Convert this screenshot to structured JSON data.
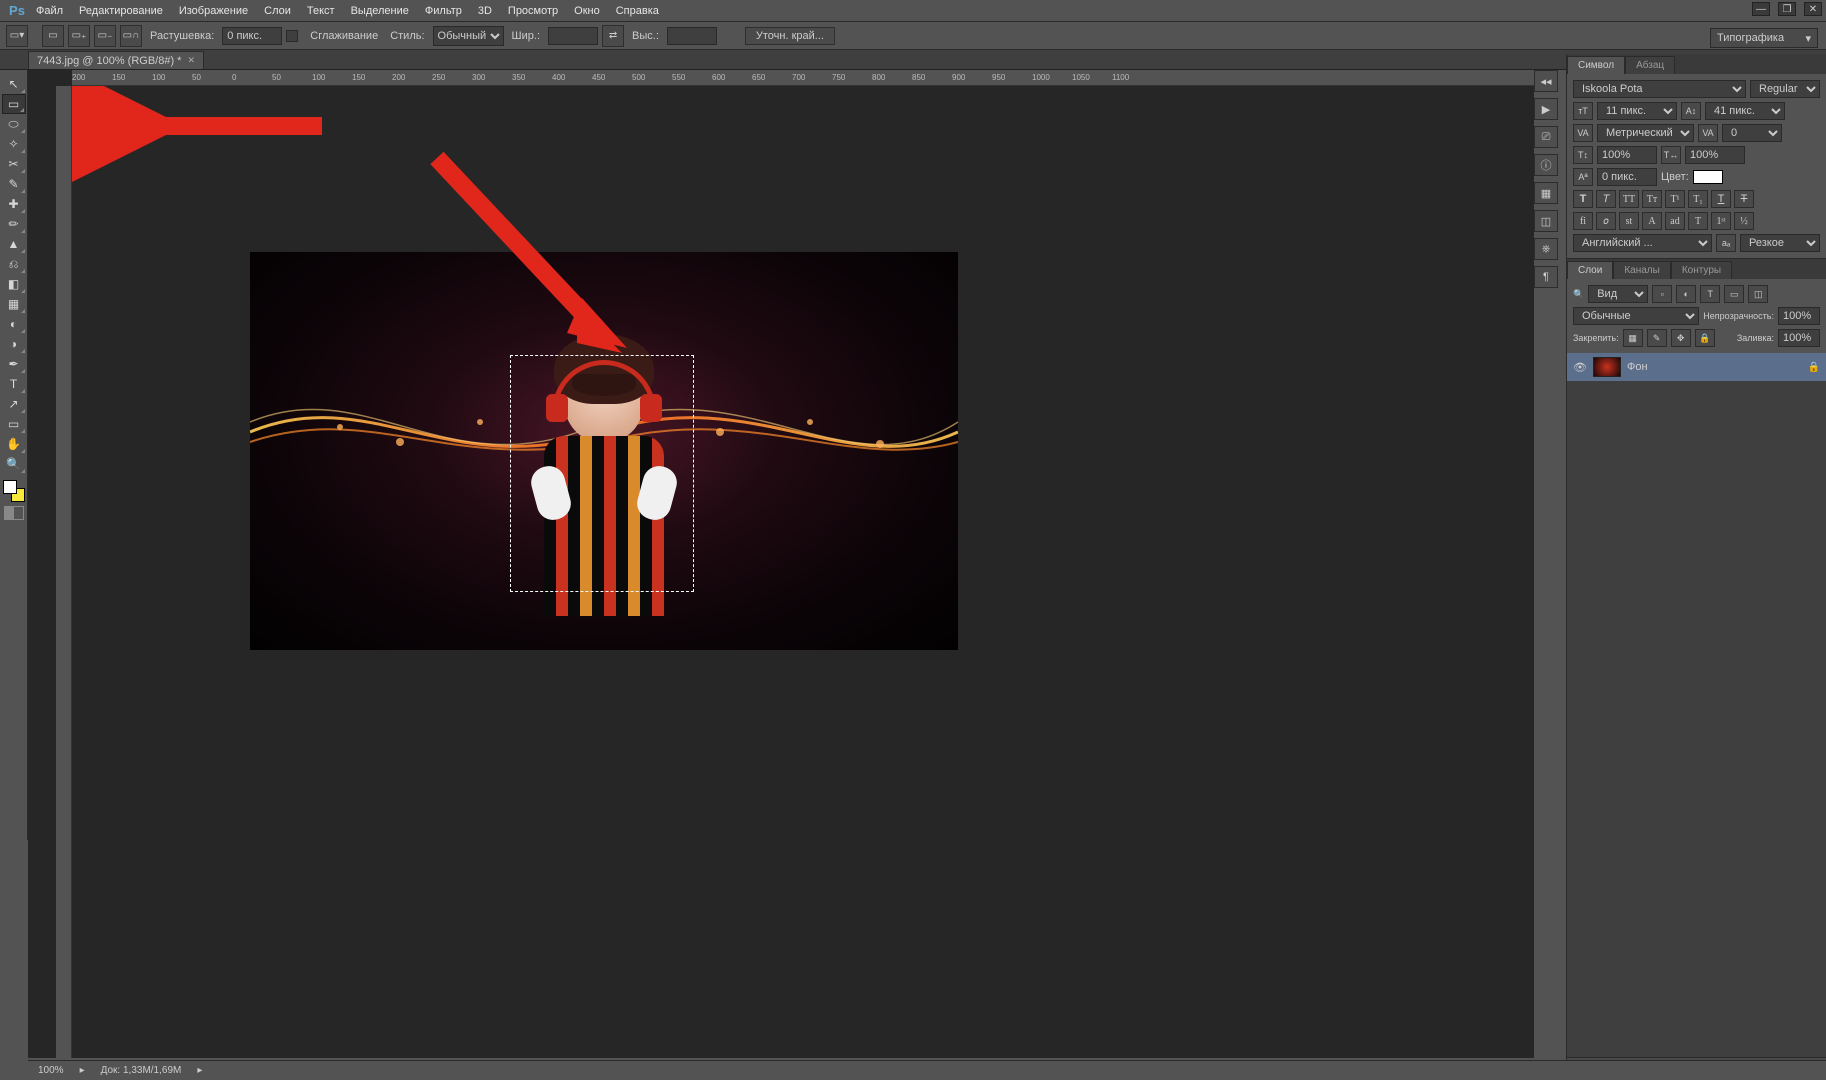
{
  "menu": {
    "logo": "Ps",
    "items": [
      "Файл",
      "Редактирование",
      "Изображение",
      "Слои",
      "Текст",
      "Выделение",
      "Фильтр",
      "3D",
      "Просмотр",
      "Окно",
      "Справка"
    ]
  },
  "winctrl": {
    "min": "—",
    "max": "❐",
    "close": "✕"
  },
  "optbar": {
    "feather_label": "Растушевка:",
    "feather_value": "0 пикс.",
    "antialias": "Сглаживание",
    "style_label": "Стиль:",
    "style_value": "Обычный",
    "width_label": "Шир.:",
    "height_label": "Выс.:",
    "refine": "Уточн. край..."
  },
  "workspace": "Типографика",
  "doc_tab": "7443.jpg @ 100% (RGB/8#) *",
  "ruler_marks": [
    "200",
    "150",
    "100",
    "50",
    "0",
    "50",
    "100",
    "150",
    "200",
    "250",
    "300",
    "350",
    "400",
    "450",
    "500",
    "550",
    "600",
    "650",
    "700",
    "750",
    "800",
    "850",
    "900",
    "950",
    "1000",
    "1050",
    "1100"
  ],
  "status": {
    "zoom": "100%",
    "docinfo": "Док: 1,33M/1,69M"
  },
  "char_panel": {
    "tab1": "Символ",
    "tab2": "Абзац",
    "font": "Iskoola Pota",
    "weight": "Regular",
    "size": "11 пикс.",
    "leading": "41 пикс.",
    "kerning": "Метрический",
    "tracking": "0",
    "scaleH": "100%",
    "scaleV": "100%",
    "baseline": "0 пикс.",
    "color_label": "Цвет:",
    "lang": "Английский ...",
    "aa": "Резкое"
  },
  "layers_panel": {
    "tab1": "Слои",
    "tab2": "Каналы",
    "tab3": "Контуры",
    "filter": "Вид",
    "blend": "Обычные",
    "opacity_label": "Непрозрачность:",
    "opacity": "100%",
    "lock_label": "Закрепить:",
    "fill_label": "Заливка:",
    "fill": "100%",
    "layer_name": "Фон"
  },
  "tools": [
    "↖",
    "▭",
    "⬚",
    "✂",
    "✥",
    "✎",
    "⎚",
    "✒",
    "⧄",
    "⎌",
    "✏",
    "▭",
    "◌",
    "△",
    "◇",
    "◐",
    "⊕",
    "✚",
    "T",
    "↗",
    "✋",
    "🔍"
  ]
}
